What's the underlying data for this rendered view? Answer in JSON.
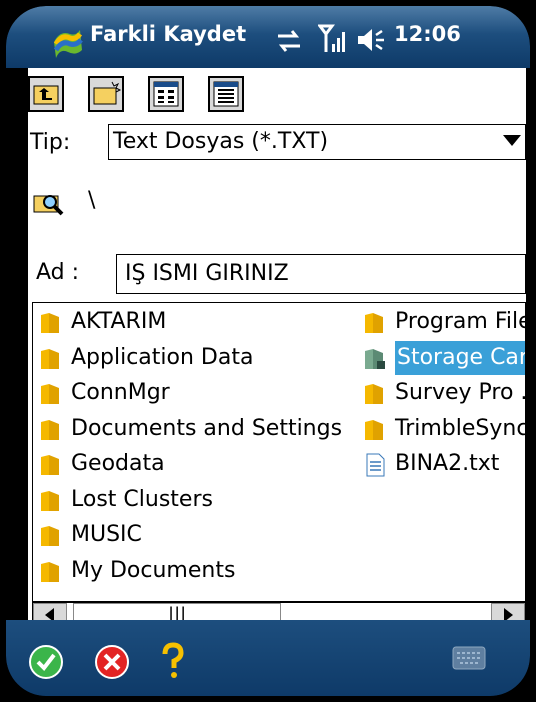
{
  "title_bar": {
    "title": "Farkli Kaydet",
    "time": "12:06",
    "icons": [
      "start-flag-icon",
      "sync-icon",
      "signal-icon",
      "speaker-icon"
    ]
  },
  "toolbar": {
    "buttons": [
      "up-folder-icon",
      "new-folder-icon",
      "list-view-icon",
      "details-view-icon"
    ]
  },
  "type_field": {
    "label": "Tip:",
    "value": "Text Dosyas (*.TXT)"
  },
  "path": {
    "icon": "folder-search-icon",
    "value": "\\"
  },
  "name_field": {
    "label": "Ad :",
    "value": "IŞ ISMI GIRINIZ"
  },
  "file_list": {
    "left_column": [
      "AKTARIM",
      "Application Data",
      "ConnMgr",
      "Documents and Settings",
      "Geodata",
      "Lost Clusters",
      "MUSIC",
      "My Documents"
    ],
    "right_column": [
      "Program File",
      "Storage Car",
      "Survey Pro .",
      "TrimbleSync",
      "BINA2.txt"
    ],
    "selected": "Storage Car"
  },
  "scrollbar": {
    "thumb_grip": "|||"
  },
  "bottom_bar": {
    "icons": [
      "ok-icon",
      "cancel-icon",
      "help-icon",
      "keyboard-icon"
    ]
  },
  "colors": {
    "selection": "#3aa0d8",
    "titlebar": "#1d4e7e",
    "folder": "#f5b800"
  }
}
